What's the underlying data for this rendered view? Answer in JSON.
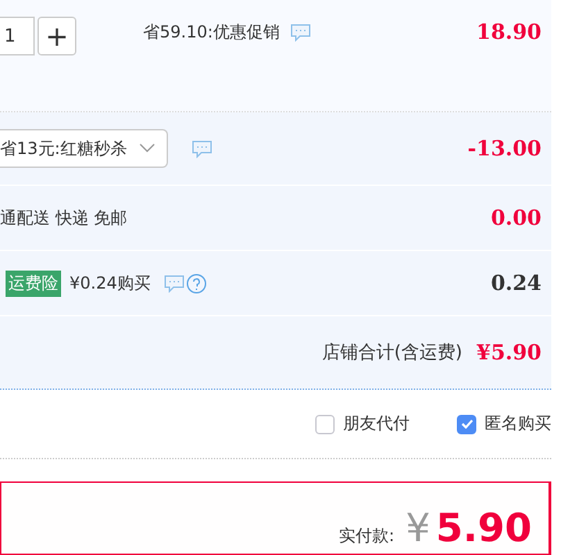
{
  "item": {
    "quantity": "1",
    "plus": "+",
    "promo": "省59.10:优惠促销",
    "price": "18.90"
  },
  "discount": {
    "select": "省13元:红糖秒杀",
    "amount": "-13.00"
  },
  "shipping": {
    "label": "通配送 快递 免邮",
    "amount": "0.00"
  },
  "insurance": {
    "badge": "运费险",
    "label": "¥0.24购买",
    "amount": "0.24"
  },
  "subtotal": {
    "label": "店铺合计(含运费)",
    "amount": "¥5.90"
  },
  "options": [
    {
      "label": "朋友代付",
      "checked": false
    },
    {
      "label": "匿名购买",
      "checked": true
    }
  ],
  "total": {
    "label": "实付款:",
    "currency": "¥",
    "amount": "5.90"
  }
}
